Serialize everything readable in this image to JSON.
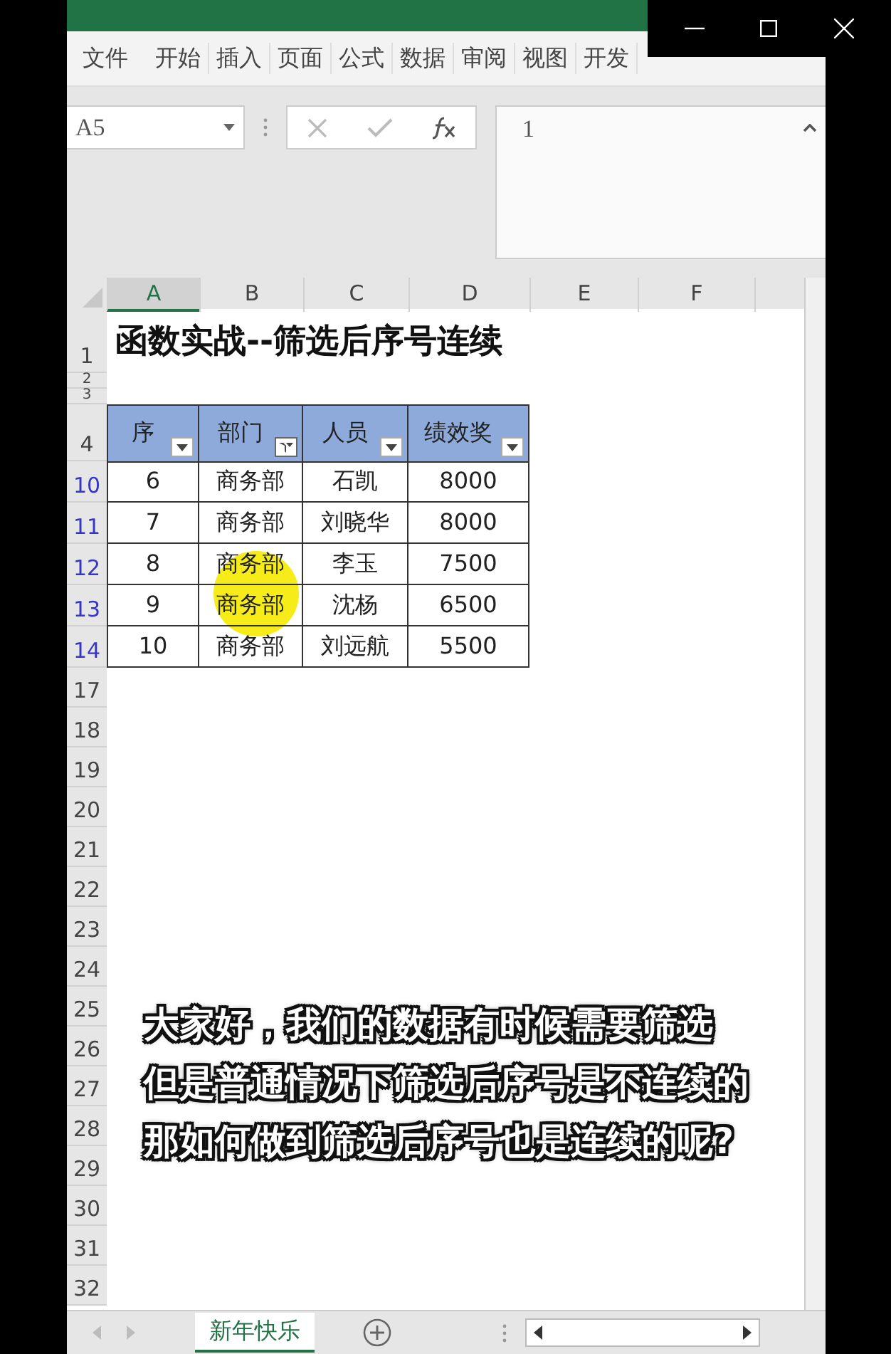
{
  "ribbon": {
    "tabs": [
      "文件",
      "开始",
      "插入",
      "页面",
      "公式",
      "数据",
      "审阅",
      "视图",
      "开发"
    ]
  },
  "formula_bar": {
    "name_box": "A5",
    "content": "1"
  },
  "columns": [
    {
      "label": "A",
      "selected": true
    },
    {
      "label": "B",
      "selected": false
    },
    {
      "label": "C",
      "selected": false
    },
    {
      "label": "D",
      "selected": false
    },
    {
      "label": "E",
      "selected": false
    },
    {
      "label": "F",
      "selected": false
    }
  ],
  "title": "函数实战--筛选后序号连续",
  "table": {
    "headers": [
      {
        "label": "序",
        "filter_active": false
      },
      {
        "label": "部门",
        "filter_active": true
      },
      {
        "label": "人员",
        "filter_active": false
      },
      {
        "label": "绩效奖",
        "filter_active": false
      }
    ],
    "rows": [
      {
        "cells": [
          "6",
          "商务部",
          "石凯",
          "8000"
        ]
      },
      {
        "cells": [
          "7",
          "商务部",
          "刘晓华",
          "8000"
        ]
      },
      {
        "cells": [
          "8",
          "商务部",
          "李玉",
          "7500"
        ]
      },
      {
        "cells": [
          "9",
          "商务部",
          "沈杨",
          "6500"
        ]
      },
      {
        "cells": [
          "10",
          "商务部",
          "刘远航",
          "5500"
        ]
      }
    ]
  },
  "rows": [
    {
      "number": "1",
      "kind": "title",
      "filtered": false
    },
    {
      "number": "2",
      "kind": "spacer",
      "filtered": false
    },
    {
      "number": "3",
      "kind": "spacer",
      "filtered": false
    },
    {
      "number": "4",
      "kind": "table_header",
      "filtered": false
    },
    {
      "number": "10",
      "kind": "table_row",
      "filtered": true
    },
    {
      "number": "11",
      "kind": "table_row",
      "filtered": true
    },
    {
      "number": "12",
      "kind": "table_row",
      "filtered": true
    },
    {
      "number": "13",
      "kind": "table_row",
      "filtered": true
    },
    {
      "number": "14",
      "kind": "table_row",
      "filtered": true
    },
    {
      "number": "17",
      "kind": "empty",
      "filtered": false
    },
    {
      "number": "18",
      "kind": "empty",
      "filtered": false
    },
    {
      "number": "19",
      "kind": "empty",
      "filtered": false
    },
    {
      "number": "20",
      "kind": "empty",
      "filtered": false
    },
    {
      "number": "21",
      "kind": "empty",
      "filtered": false
    },
    {
      "number": "22",
      "kind": "empty",
      "filtered": false
    },
    {
      "number": "23",
      "kind": "empty",
      "filtered": false
    },
    {
      "number": "24",
      "kind": "empty",
      "filtered": false
    },
    {
      "number": "25",
      "kind": "empty",
      "filtered": false
    },
    {
      "number": "26",
      "kind": "empty",
      "filtered": false
    },
    {
      "number": "27",
      "kind": "empty",
      "filtered": false
    },
    {
      "number": "28",
      "kind": "empty",
      "filtered": false
    },
    {
      "number": "29",
      "kind": "empty",
      "filtered": false
    },
    {
      "number": "30",
      "kind": "empty",
      "filtered": false
    },
    {
      "number": "31",
      "kind": "empty",
      "filtered": false
    },
    {
      "number": "32",
      "kind": "empty",
      "filtered": false
    }
  ],
  "subtitle": [
    "大家好，我们的数据有时候需要筛选",
    "但是普通情况下筛选后序号是不连续的",
    "那如何做到筛选后序号也是连续的呢?"
  ],
  "sheet_tabs": [
    {
      "label": "新年快乐",
      "selected": true
    }
  ]
}
